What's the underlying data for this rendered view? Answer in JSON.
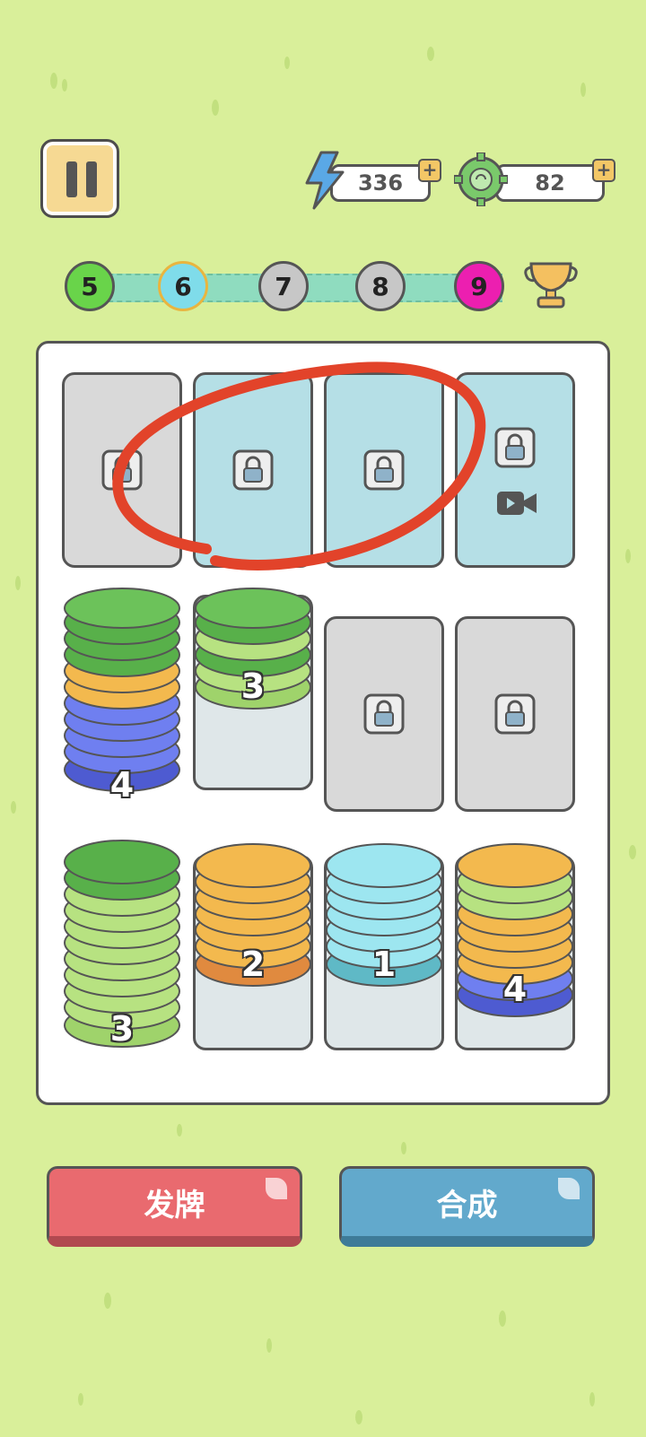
{
  "resources": {
    "energy": {
      "value": "336",
      "icon": "lightning-icon",
      "plus": "+"
    },
    "gears": {
      "value": "82",
      "icon": "gear-coin-icon",
      "plus": "+"
    }
  },
  "levels": [
    {
      "label": "5",
      "color": "#69d44a"
    },
    {
      "label": "6",
      "color": "#7fdcea"
    },
    {
      "label": "7",
      "color": "#c7c7c7"
    },
    {
      "label": "8",
      "color": "#c7c7c7"
    },
    {
      "label": "9",
      "color": "#ec1fb0"
    }
  ],
  "board": {
    "row1": [
      {
        "state": "locked",
        "bg": "gray"
      },
      {
        "state": "locked",
        "bg": "blue"
      },
      {
        "state": "locked",
        "bg": "blue"
      },
      {
        "state": "locked-video",
        "bg": "blue"
      }
    ],
    "row2": [
      {
        "count": "4",
        "top_color": "blue"
      },
      {
        "count": "3",
        "top_color": "lightgreen"
      },
      {
        "state": "locked",
        "bg": "gray"
      },
      {
        "state": "locked",
        "bg": "gray"
      }
    ],
    "row3": [
      {
        "count": "3",
        "top_color": "lightgreen"
      },
      {
        "count": "2",
        "top_color": "orange"
      },
      {
        "count": "1",
        "top_color": "cyan"
      },
      {
        "count": "4",
        "top_color": "blue"
      }
    ]
  },
  "buttons": {
    "deal": "发牌",
    "merge": "合成"
  },
  "colors": {
    "background": "#d9ef9a",
    "annotation": "#e2432a"
  }
}
